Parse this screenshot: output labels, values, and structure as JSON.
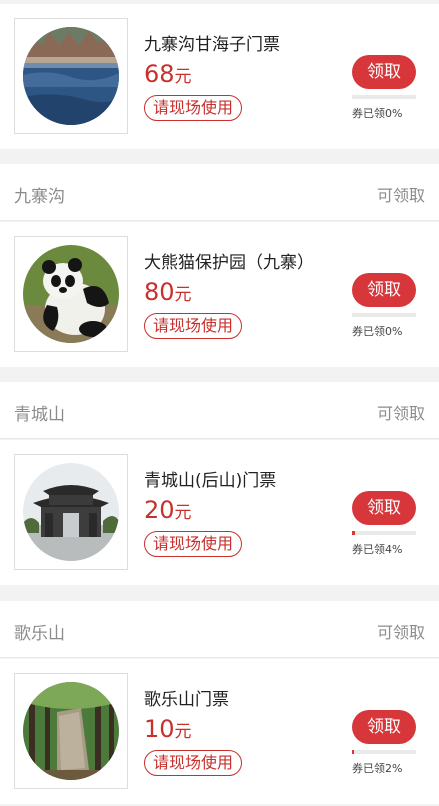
{
  "items": [
    {
      "section_name": "",
      "section_status": "",
      "title": "九寨沟甘海子门票",
      "price": "68",
      "unit": "元",
      "usage": "请现场使用",
      "claim_label": "领取",
      "claimed_text": "券已领0%",
      "claimed_fraction": 0.0,
      "image": "lake-forest-photo"
    },
    {
      "section_name": "九寨沟",
      "section_status": "可领取",
      "title": "大熊猫保护园（九寨）",
      "price": "80",
      "unit": "元",
      "usage": "请现场使用",
      "claim_label": "领取",
      "claimed_text": "券已领0%",
      "claimed_fraction": 0.0,
      "image": "panda-photo"
    },
    {
      "section_name": "青城山",
      "section_status": "可领取",
      "title": "青城山(后山)门票",
      "price": "20",
      "unit": "元",
      "usage": "请现场使用",
      "claim_label": "领取",
      "claimed_text": "券已领4%",
      "claimed_fraction": 0.04,
      "image": "temple-gate-photo"
    },
    {
      "section_name": "歌乐山",
      "section_status": "可领取",
      "title": "歌乐山门票",
      "price": "10",
      "unit": "元",
      "usage": "请现场使用",
      "claim_label": "领取",
      "claimed_text": "券已领2%",
      "claimed_fraction": 0.02,
      "image": "forest-monument-photo"
    }
  ],
  "colors": {
    "accent": "#d7373a",
    "price": "#c8302c",
    "muted": "#8c8c8c"
  }
}
